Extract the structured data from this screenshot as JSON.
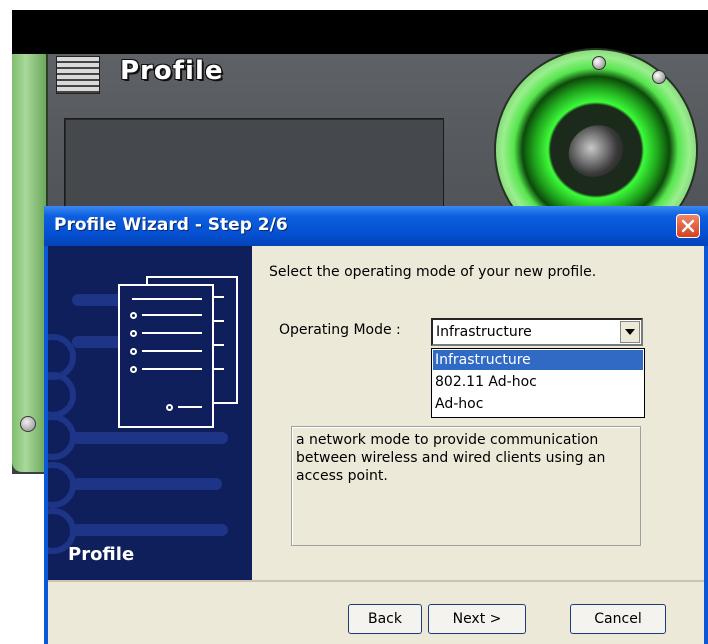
{
  "app": {
    "title": "Profile",
    "icon": "profile-app-icon",
    "accent": "#3dfb3a"
  },
  "dialog": {
    "title": "Profile Wizard - Step 2/6",
    "close_icon": "close-icon",
    "side_label": "Profile",
    "instruction": "Select the operating mode of your new profile.",
    "mode_label": "Operating Mode :",
    "mode_value": "Infrastructure",
    "options": [
      "Infrastructure",
      "802.11 Ad-hoc",
      "Ad-hoc"
    ],
    "selected_option": "Infrastructure",
    "description": "a network mode to provide communication between wireless and wired clients using an access point.",
    "buttons": {
      "back": "Back",
      "next": "Next >",
      "cancel": "Cancel"
    },
    "colors": {
      "titlebar": "#0550d2",
      "side_panel": "#0f1f5c",
      "selection": "#316ac5",
      "close": "#d6401e"
    }
  }
}
